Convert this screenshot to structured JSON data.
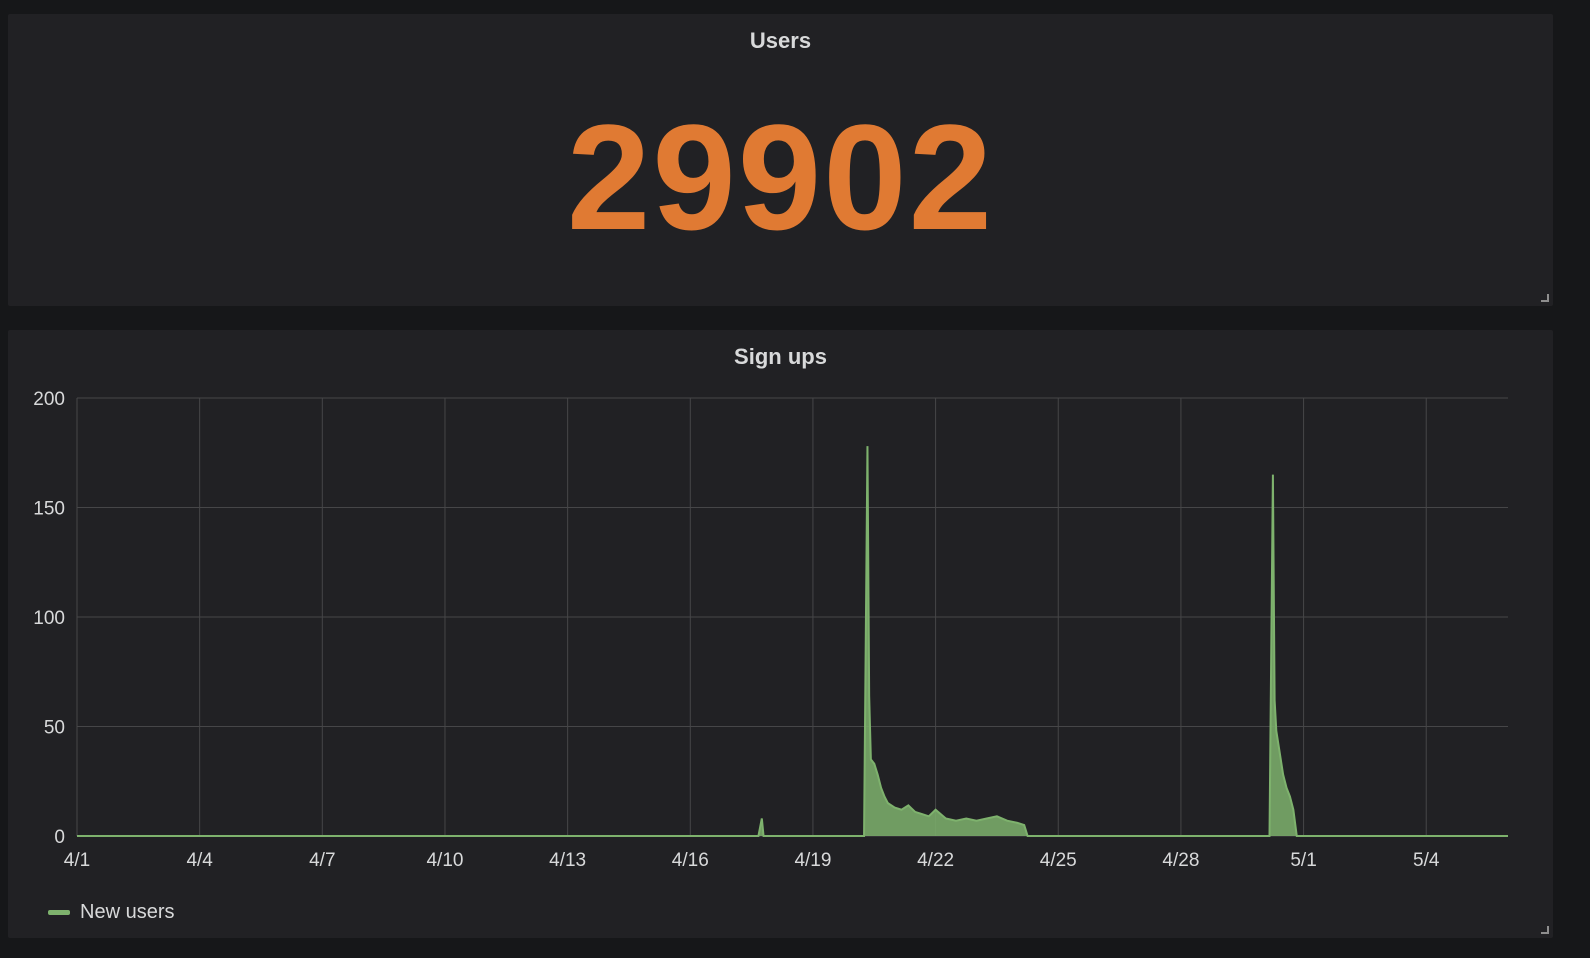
{
  "stat_panel": {
    "title": "Users",
    "value": "29902",
    "value_color": "#e07a33"
  },
  "chart_panel": {
    "title": "Sign ups",
    "legend_label": "New users"
  },
  "colors": {
    "background": "#161719",
    "panel": "#212124",
    "grid": "#464648",
    "series": "#7eb26d"
  },
  "chart_data": {
    "type": "area",
    "title": "Sign ups",
    "xlabel": "",
    "ylabel": "",
    "x_unit": "date",
    "xlim": [
      "4/1",
      "5/6"
    ],
    "ylim": [
      0,
      200
    ],
    "y_ticks": [
      0,
      50,
      100,
      150,
      200
    ],
    "x_ticks": [
      "4/1",
      "4/4",
      "4/7",
      "4/10",
      "4/13",
      "4/16",
      "4/19",
      "4/22",
      "4/25",
      "4/28",
      "5/1",
      "5/4"
    ],
    "grid": true,
    "legend_position": "bottom-left",
    "series": [
      {
        "name": "New users",
        "color": "#7eb26d",
        "points": [
          [
            "4/1",
            0
          ],
          [
            "4/17 12:00",
            0
          ],
          [
            "4/17 16:00",
            0
          ],
          [
            "4/17 18:00",
            8
          ],
          [
            "4/17 19:00",
            0
          ],
          [
            "4/20 06:00",
            0
          ],
          [
            "4/20 08:00",
            178
          ],
          [
            "4/20 09:00",
            64
          ],
          [
            "4/20 10:00",
            35
          ],
          [
            "4/20 12:00",
            33
          ],
          [
            "4/20 14:00",
            28
          ],
          [
            "4/20 16:00",
            22
          ],
          [
            "4/20 18:00",
            18
          ],
          [
            "4/20 20:00",
            15
          ],
          [
            "4/21 00:00",
            13
          ],
          [
            "4/21 04:00",
            12
          ],
          [
            "4/21 08:00",
            14
          ],
          [
            "4/21 12:00",
            11
          ],
          [
            "4/21 16:00",
            10
          ],
          [
            "4/21 20:00",
            9
          ],
          [
            "4/22 00:00",
            12
          ],
          [
            "4/22 06:00",
            8
          ],
          [
            "4/22 12:00",
            7
          ],
          [
            "4/22 18:00",
            8
          ],
          [
            "4/23 00:00",
            7
          ],
          [
            "4/23 06:00",
            8
          ],
          [
            "4/23 12:00",
            9
          ],
          [
            "4/23 18:00",
            7
          ],
          [
            "4/24 00:00",
            6
          ],
          [
            "4/24 04:00",
            5
          ],
          [
            "4/24 06:00",
            0
          ],
          [
            "4/30 04:00",
            0
          ],
          [
            "4/30 06:00",
            165
          ],
          [
            "4/30 07:00",
            62
          ],
          [
            "4/30 08:00",
            48
          ],
          [
            "4/30 10:00",
            38
          ],
          [
            "4/30 12:00",
            28
          ],
          [
            "4/30 14:00",
            22
          ],
          [
            "4/30 16:00",
            18
          ],
          [
            "4/30 18:00",
            12
          ],
          [
            "4/30 20:00",
            0
          ],
          [
            "5/6",
            0
          ]
        ]
      }
    ]
  }
}
